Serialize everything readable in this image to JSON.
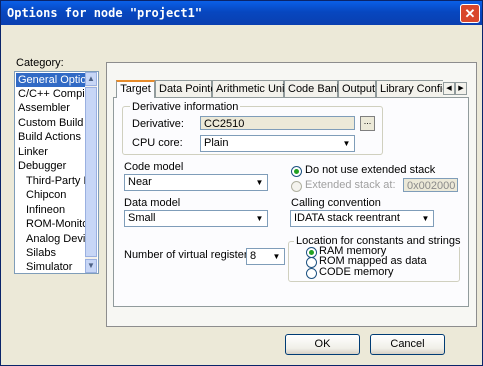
{
  "window": {
    "title": "Options for node \"project1\"",
    "close_glyph": "✕"
  },
  "category": {
    "label": "Category:",
    "items": [
      "General Options",
      "C/C++ Compiler",
      "Assembler",
      "Custom Build",
      "Build Actions",
      "Linker",
      "Debugger",
      "Third-Party Driver",
      "Chipcon",
      "Infineon",
      "ROM-Monitor",
      "Analog Devices",
      "Silabs",
      "Simulator"
    ],
    "selected_index": 0
  },
  "tabs": [
    "Target",
    "Data Pointer",
    "Arithmetic Unit",
    "Code Bank",
    "Output",
    "Library Configuration"
  ],
  "active_tab_index": 0,
  "derivative": {
    "group_label": "Derivative information",
    "derivative_label": "Derivative:",
    "derivative_value": "CC2510",
    "browse_glyph": "...",
    "cpu_label": "CPU core:",
    "cpu_value": "Plain"
  },
  "code_model": {
    "label": "Code model",
    "value": "Near"
  },
  "data_model": {
    "label": "Data model",
    "value": "Small"
  },
  "stack": {
    "no_extended_label": "Do not use extended stack",
    "no_extended_checked": true,
    "extended_label": "Extended stack at:",
    "extended_value": "0x002000",
    "extended_enabled": false
  },
  "calling": {
    "label": "Calling convention",
    "value": "IDATA stack reentrant"
  },
  "virtual_registers": {
    "label": "Number of virtual registers:",
    "value": "8"
  },
  "location": {
    "group_label": "Location for constants and strings",
    "options": [
      "RAM memory",
      "ROM mapped as data",
      "CODE memory"
    ],
    "selected_index": 0
  },
  "buttons": {
    "ok": "OK",
    "cancel": "Cancel"
  }
}
